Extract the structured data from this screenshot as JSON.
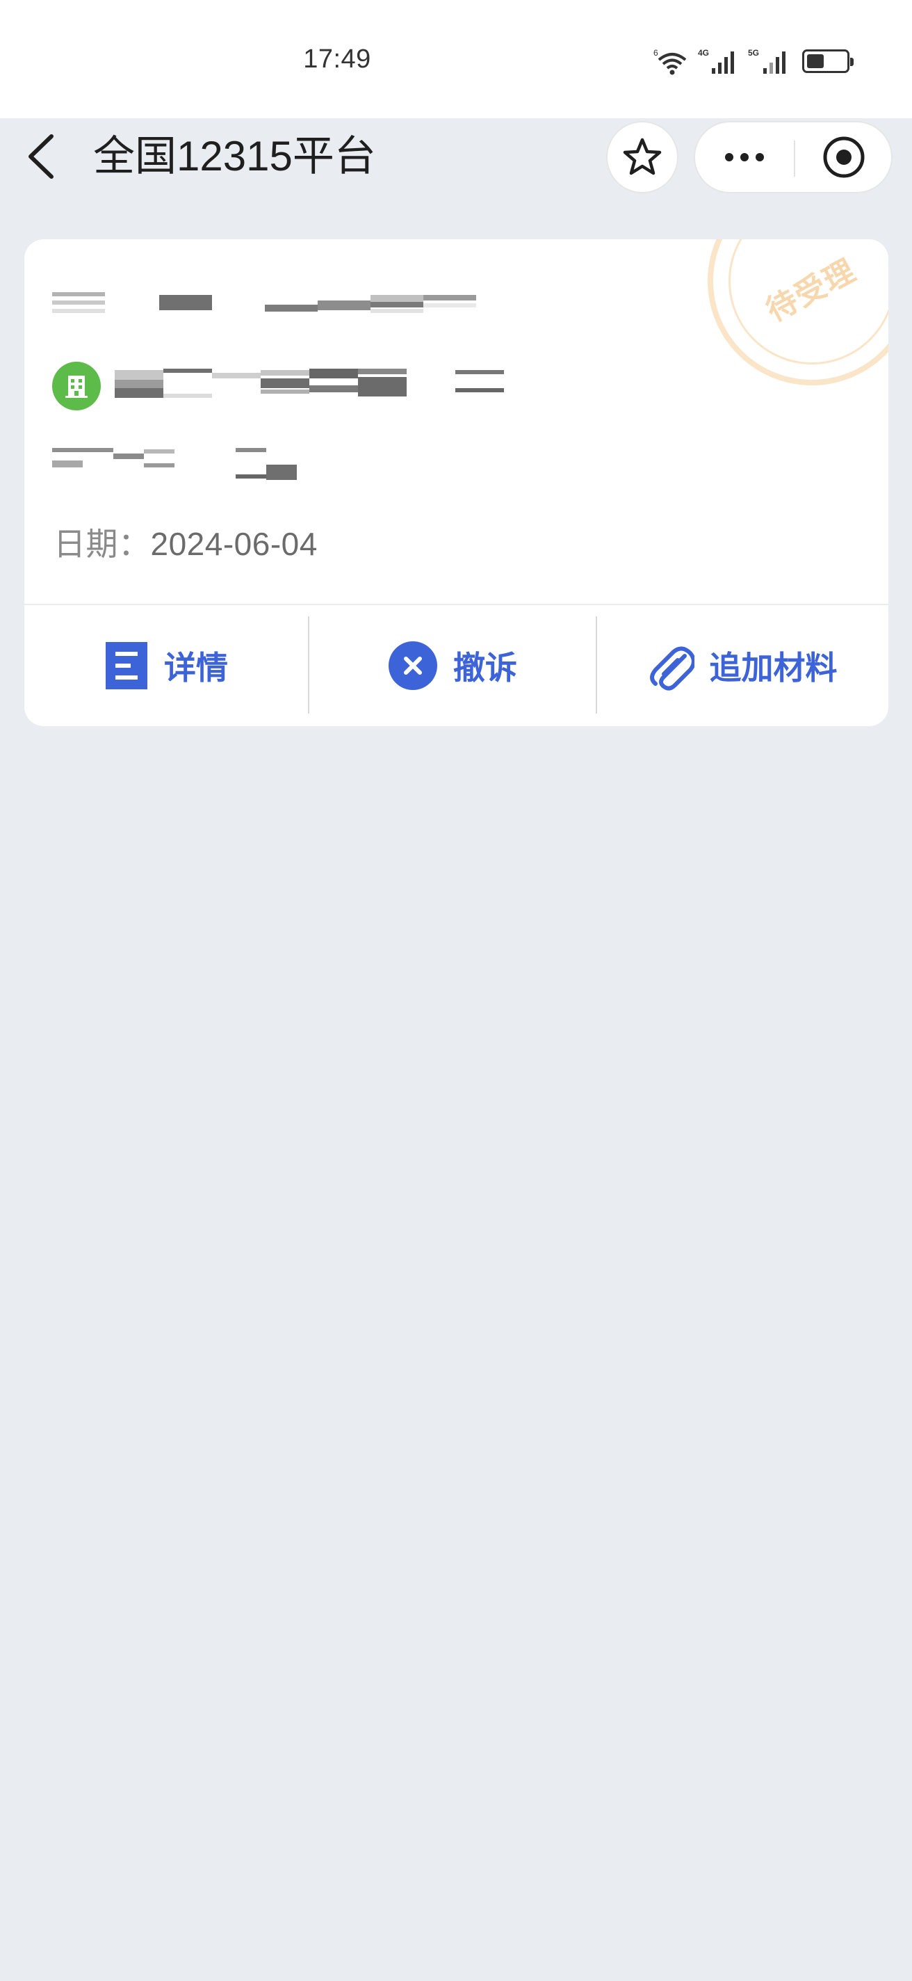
{
  "status_bar": {
    "time": "17:49",
    "icons": [
      "wifi-icon",
      "signal-4g-icon",
      "signal-5g-icon",
      "battery-icon"
    ],
    "battery_level": 0.45
  },
  "nav": {
    "title": "全国12315平台",
    "back_icon": "chevron-left-icon",
    "favorite_icon": "star-icon",
    "more_icon": "more-dots-icon",
    "close_icon": "target-circle-icon"
  },
  "card": {
    "stamp_text": "待受理",
    "company_icon": "building-icon",
    "date_label": "日期：",
    "date_value": "2024-06-04",
    "actions": [
      {
        "label": "详情",
        "icon": "document-list-icon"
      },
      {
        "label": "撤诉",
        "icon": "close-circle-icon"
      },
      {
        "label": "追加材料",
        "icon": "paperclip-icon"
      }
    ]
  },
  "colors": {
    "accent": "#3d63d8",
    "page_bg": "#e9ecf1",
    "stamp": "#fbe5c8",
    "company_badge": "#5dbb4a"
  }
}
